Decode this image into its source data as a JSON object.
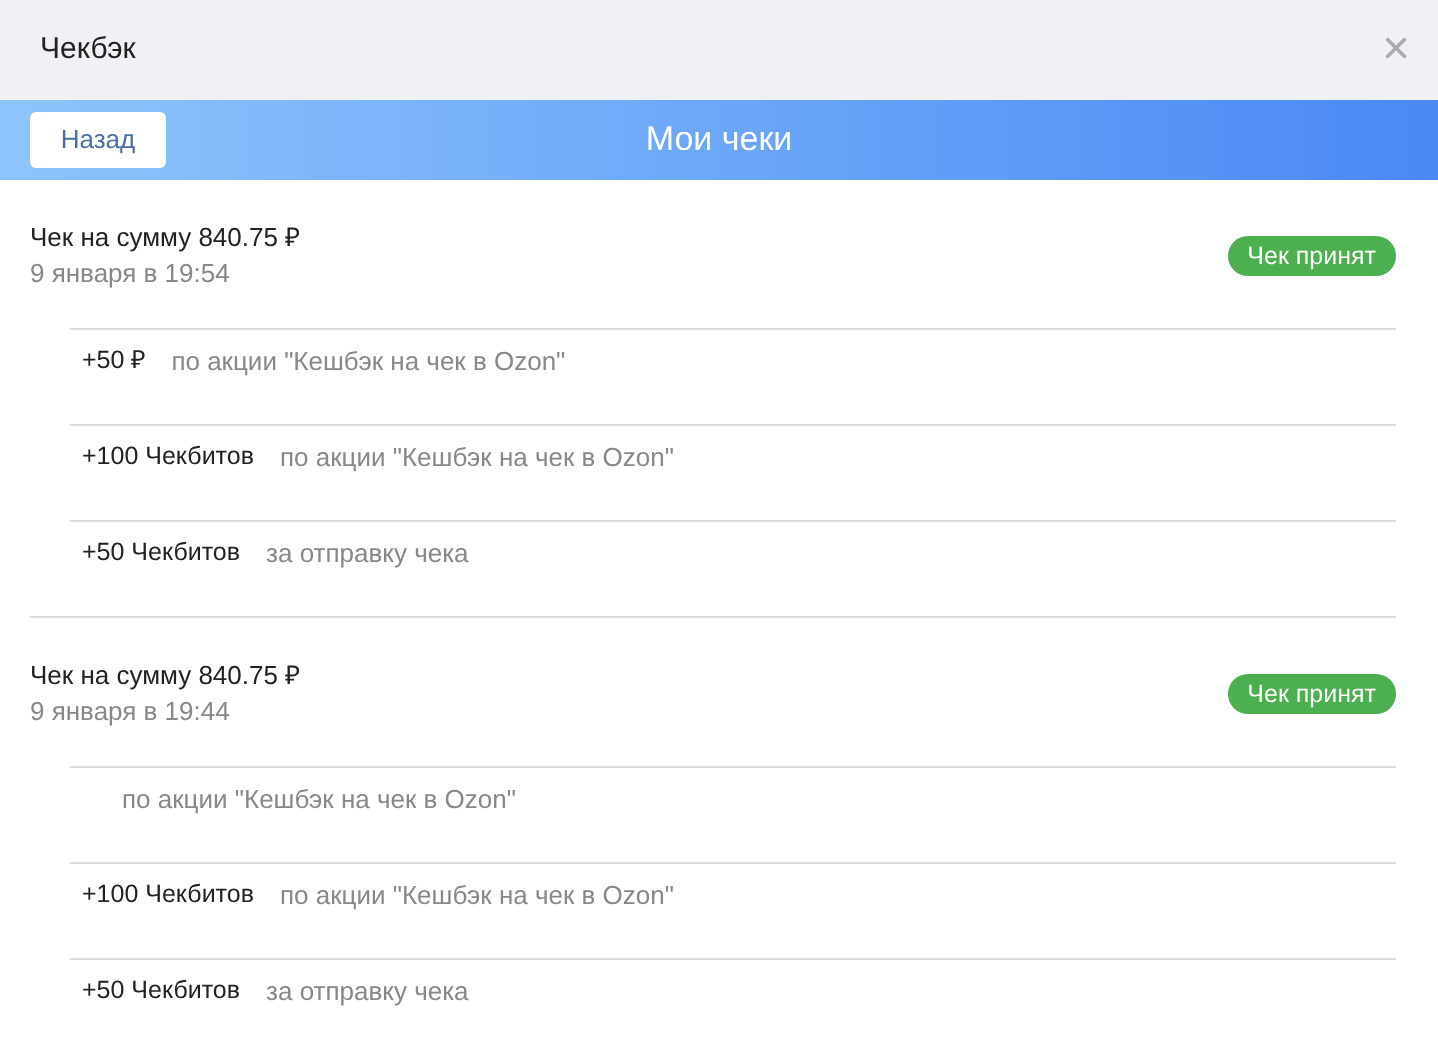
{
  "window": {
    "title": "Чекбэк",
    "close": "×"
  },
  "banner": {
    "back_button": "Назад",
    "title": "Мои чеки"
  },
  "receipts": [
    {
      "title": "Чек на сумму 840.75 ₽",
      "date": "9 января в 19:54",
      "status": "Чек принят",
      "rows": [
        {
          "amount": "+50 ₽",
          "reason": "по акции \"Кешбэк на чек в Ozon\""
        },
        {
          "amount": "+100 Чекбитов",
          "reason": "по акции \"Кешбэк на чек в Ozon\""
        },
        {
          "amount": "+50 Чекбитов",
          "reason": "за отправку чека"
        }
      ]
    },
    {
      "title": "Чек на сумму 840.75 ₽",
      "date": "9 января в 19:44",
      "status": "Чек принят",
      "rows": [
        {
          "reason": "по акции \"Кешбэк на чек в Ozon\""
        },
        {
          "amount": "+100 Чекбитов",
          "reason": "по акции \"Кешбэк на чек в Ozon\""
        },
        {
          "amount": "+50 Чекбитов",
          "reason": "за отправку чека"
        }
      ]
    }
  ]
}
